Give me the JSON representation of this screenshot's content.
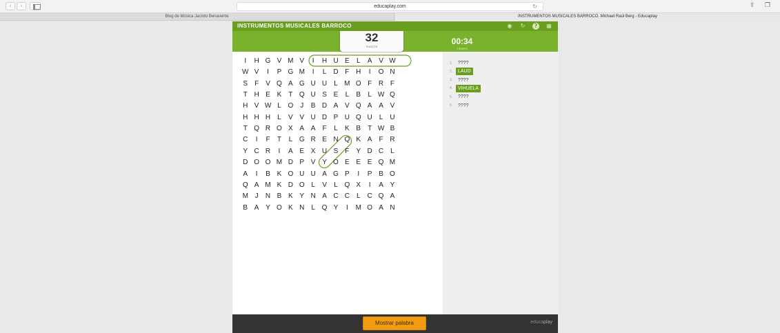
{
  "browser": {
    "address": "educaplay.com",
    "tabs": [
      "Blog de Música Jacinto Benavente",
      "INSTRUMENTOS MUSICALES BARROCO. Michael Raúl Berg - Educaplay"
    ]
  },
  "game": {
    "title": "INSTRUMENTOS MUSICALES BARROCO",
    "score": "32",
    "score_label": "PUNTOS",
    "timer": "00:34",
    "timer_label": "TIEMPO",
    "grid": [
      "IHGVMVIHUELAVW",
      "WVIPGMILDFHION",
      "SFVQAGUULMOFRF",
      "THEKTQUSELBLWQ",
      "HVWLOJBDAVQAAV",
      "HHHLVVUDPUQULU",
      "TQROXAAFLKBTWB",
      "CIFTLGRENQKAFR",
      "YCRIAEXUSFYDCL",
      "DOOMDPVYOEEEQM",
      "AIBKOUUAGPIPBO",
      "QAMKDOLVLQXIAY",
      "MJNBKYNACCLCQA",
      "BAYOKNLQYIMOAN"
    ],
    "words": [
      {
        "num": "1.",
        "text": "????",
        "found": false
      },
      {
        "num": "2.",
        "text": "LAUD",
        "found": true
      },
      {
        "num": "3.",
        "text": "????",
        "found": false
      },
      {
        "num": "4.",
        "text": "VIHUELA",
        "found": true
      },
      {
        "num": "5.",
        "text": "????",
        "found": false
      },
      {
        "num": "6.",
        "text": "????",
        "found": false
      }
    ],
    "show_word_button": "Mostrar palabra",
    "brand": [
      "educa",
      "play"
    ]
  },
  "colors": {
    "title_green": "#6a9e1f",
    "score_green": "#7ab22d",
    "button_orange": "#f39c12",
    "mark_green": "#6a9e1f"
  }
}
